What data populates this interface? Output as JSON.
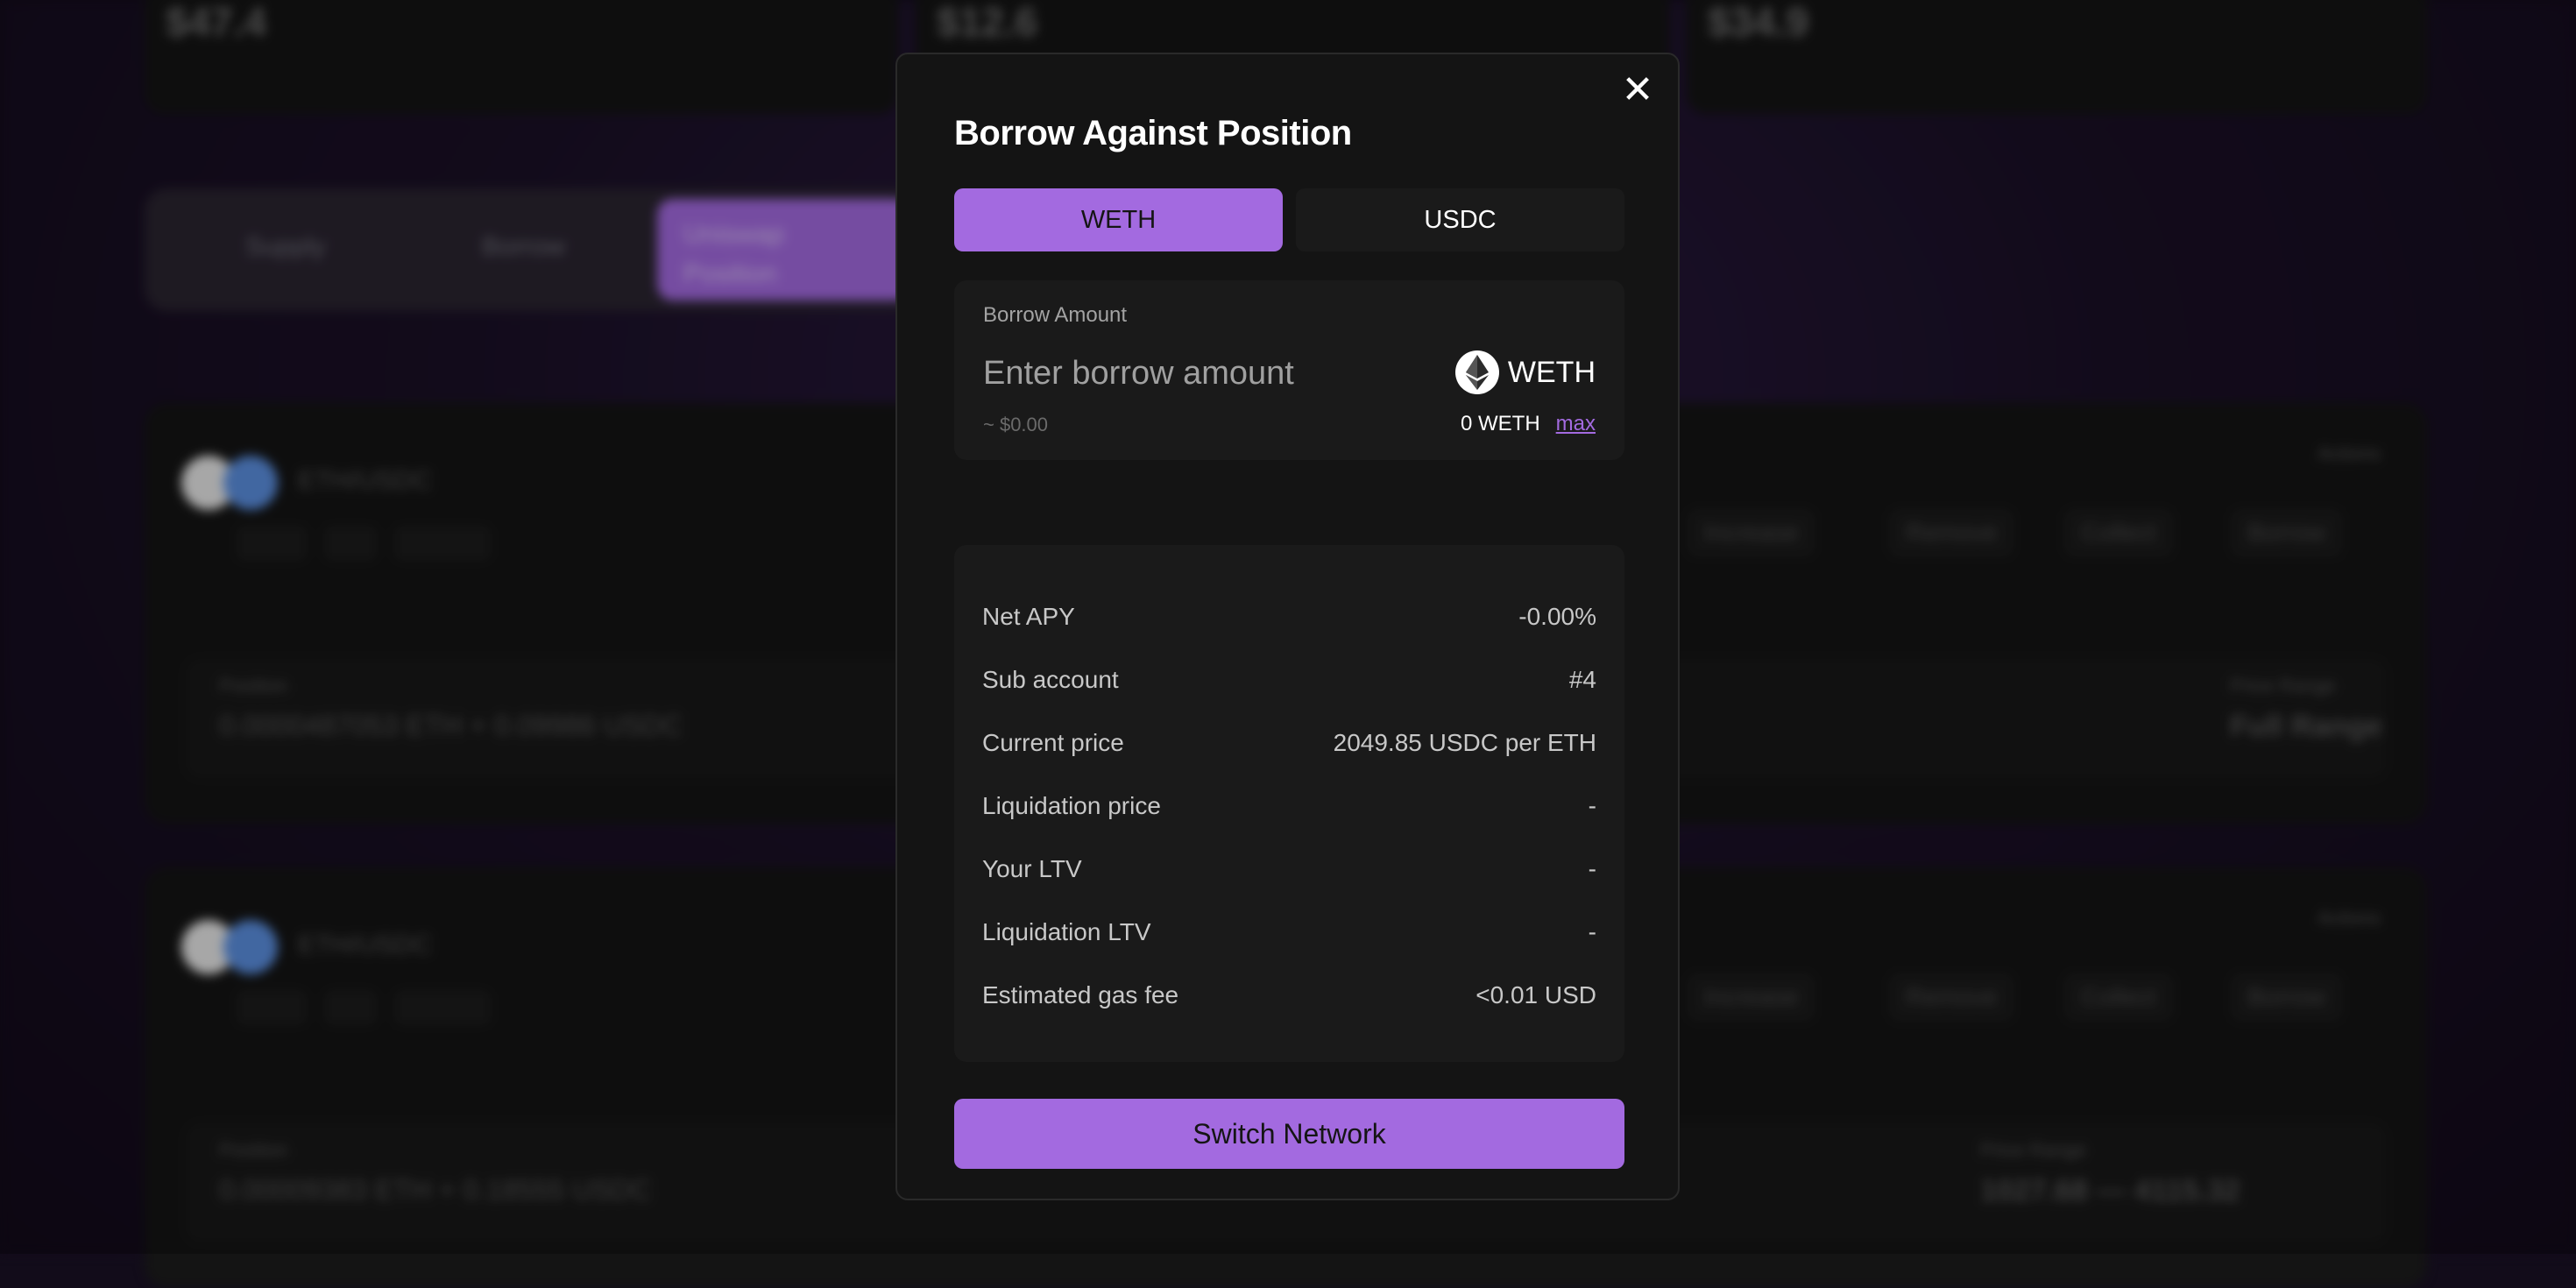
{
  "background": {
    "stats": [
      "$47.4",
      "$12.6",
      "$34.9"
    ],
    "tabs": [
      "Supply",
      "Borrow",
      "Uniswap Position"
    ],
    "cards": [
      {
        "pair": "ETH/USDC",
        "chips": [
          "0.05%",
          "V4",
          "Uniswap"
        ],
        "actions_label": "Actions",
        "actions": [
          "Increase",
          "Remove",
          "Collect",
          "Borrow"
        ],
        "position_label": "Position",
        "position_value": "0.0000487053 ETH + 0.09986 USDC",
        "range_label": "Price Range",
        "range_value": "Full Range"
      },
      {
        "pair": "ETH/USDC",
        "chips": [
          "0.05%",
          "V4",
          "Uniswap"
        ],
        "actions_label": "Actions",
        "actions": [
          "Increase",
          "Remove",
          "Collect",
          "Borrow"
        ],
        "position_label": "Position",
        "position_value": "0.00009383 ETH + 0.18555 USDC",
        "range_label": "Price Range",
        "range_value": "1027.68 — 4115.32"
      }
    ]
  },
  "modal": {
    "title": "Borrow Against Position",
    "tabs": {
      "weth": "WETH",
      "usdc": "USDC"
    },
    "amount": {
      "label": "Borrow Amount",
      "placeholder": "Enter borrow amount",
      "token": "WETH",
      "usd_value": "~ $0.00",
      "balance": "0 WETH",
      "max_label": "max"
    },
    "details": [
      {
        "label": "Net APY",
        "value": "-0.00%"
      },
      {
        "label": "Sub account",
        "value": "#4"
      },
      {
        "label": "Current price",
        "value": "2049.85 USDC per ETH"
      },
      {
        "label": "Liquidation price",
        "value": "-"
      },
      {
        "label": "Your LTV",
        "value": "-"
      },
      {
        "label": "Liquidation LTV",
        "value": "-"
      },
      {
        "label": "Estimated gas fee",
        "value": "<0.01 USD"
      }
    ],
    "action_button": "Switch Network"
  },
  "colors": {
    "accent": "#a36ae0",
    "modal_bg": "#141414",
    "panel_bg": "#1a1a1a"
  }
}
